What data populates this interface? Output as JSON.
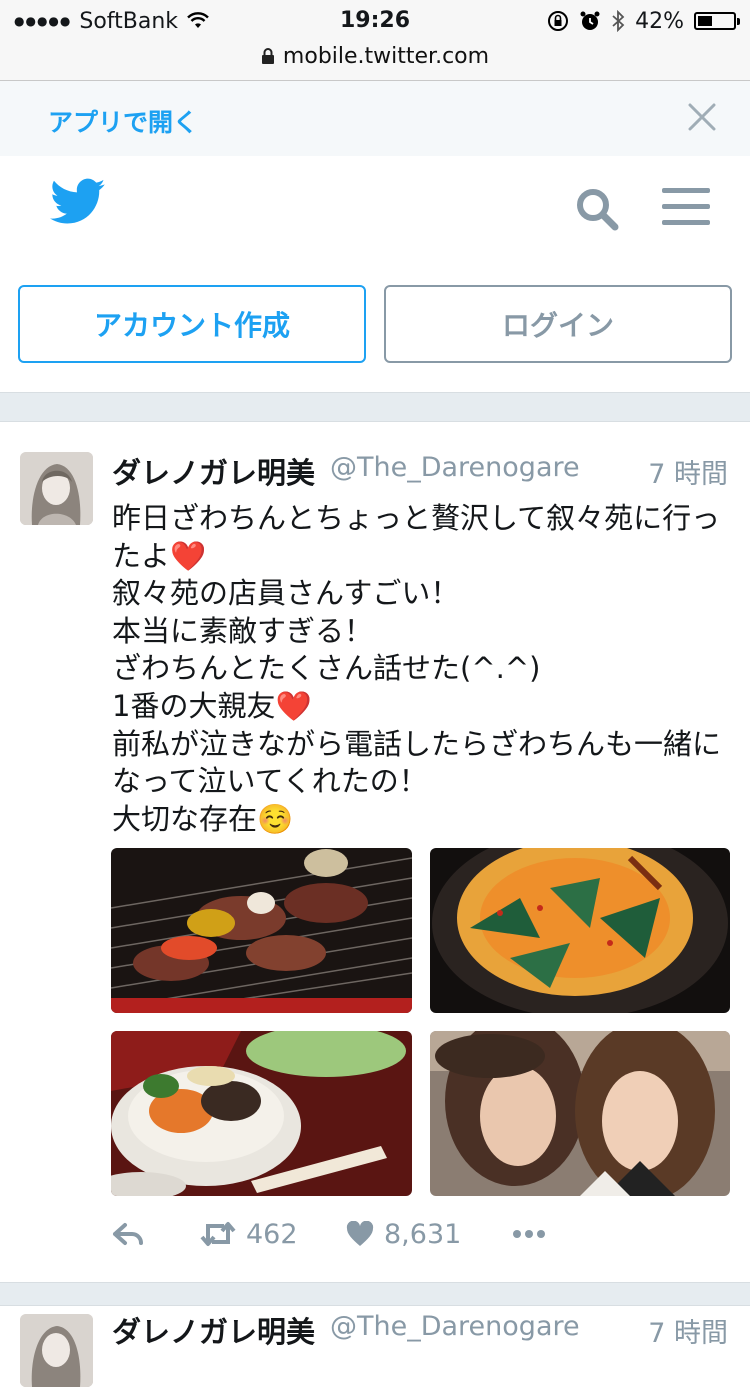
{
  "status_bar": {
    "carrier": "SoftBank",
    "time": "19:26",
    "battery": "42%",
    "battery_level": 0.42
  },
  "browser": {
    "url": "mobile.twitter.com"
  },
  "banner": {
    "open_in_app": "アプリで開く"
  },
  "auth": {
    "signup": "アカウント作成",
    "login": "ログイン"
  },
  "tweets": [
    {
      "name": "ダレノガレ明美",
      "handle": "@The_Darenogare",
      "time": "7 時間",
      "text": "昨日ざわちんとちょっと贅沢して叙々苑に行ったよ❤️\n叙々苑の店員さんすごい！\n本当に素敵すぎる！\nざわちんとたくさん話せた(^.^)\n1番の大親友❤️\n前私が泣きながら電話したらざわちんも一緒になって泣いてくれたの！\n大切な存在☺️",
      "retweets": "462",
      "likes": "8,631"
    },
    {
      "name": "ダレノガレ明美",
      "handle": "@The_Darenogare",
      "time": "7 時間"
    }
  ],
  "colors": {
    "brand": "#1da1f2",
    "muted": "#8899a6",
    "like": "#e0245e"
  },
  "icons": [
    "wifi-icon",
    "lock-icon",
    "rotation-lock-icon",
    "alarm-icon",
    "bluetooth-icon",
    "battery-icon",
    "close-icon",
    "twitter-bird-icon",
    "search-icon",
    "menu-icon",
    "reply-icon",
    "retweet-icon",
    "like-icon",
    "more-icon"
  ]
}
